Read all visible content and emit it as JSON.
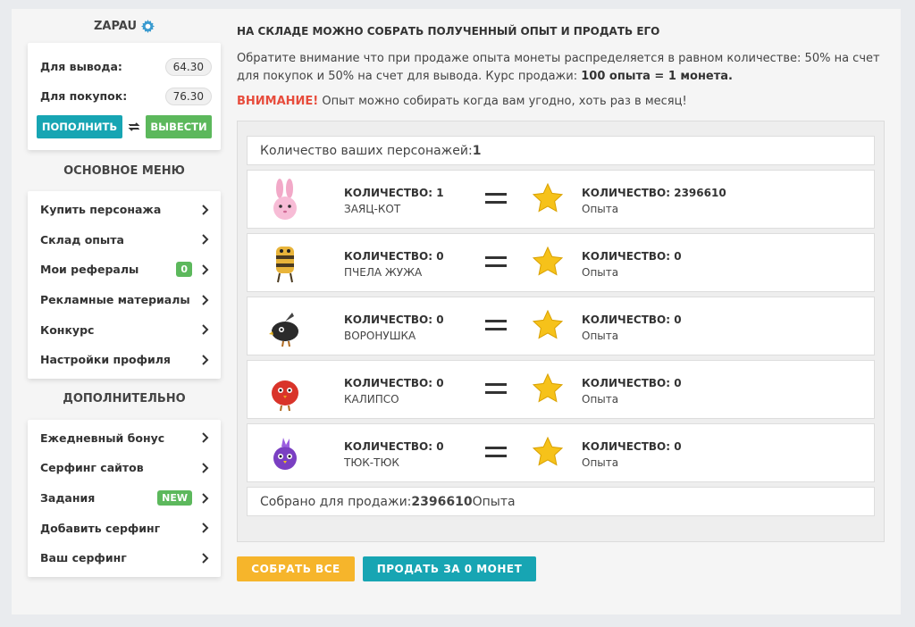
{
  "user": {
    "name": "ZAPAU"
  },
  "balance": {
    "withdraw_label": "Для вывода:",
    "withdraw_value": "64.30",
    "purchase_label": "Для покупок:",
    "purchase_value": "76.30",
    "topup_label": "ПОПОЛНИТЬ",
    "withdraw_button": "ВЫВЕСТИ"
  },
  "main_menu": {
    "title": "ОСНОВНОЕ МЕНЮ",
    "items": [
      {
        "label": "Купить персонажа"
      },
      {
        "label": "Склад опыта"
      },
      {
        "label": "Мои рефералы",
        "badge": "0"
      },
      {
        "label": "Рекламные материалы"
      },
      {
        "label": "Конкурс"
      },
      {
        "label": "Настройки профиля"
      }
    ]
  },
  "extra_menu": {
    "title": "ДОПОЛНИТЕЛЬНО",
    "items": [
      {
        "label": "Ежедневный бонус"
      },
      {
        "label": "Серфинг сайтов"
      },
      {
        "label": "Задания",
        "badge": "NEW"
      },
      {
        "label": "Добавить серфинг"
      },
      {
        "label": "Ваш серфинг"
      }
    ]
  },
  "main": {
    "title": "НА СКЛАДЕ МОЖНО СОБРАТЬ ПОЛУЧЕННЫЙ ОПЫТ И ПРОДАТЬ ЕГО",
    "desc_text": "Обратите внимание что при продаже опыта монеты распределяется в равном количестве: 50% на счет для покупок и 50% на счет для вывода. Курс продажи: ",
    "desc_rate": "100 опыта = 1 монета.",
    "warn_label": "ВНИМАНИЕ!",
    "warn_text": " Опыт можно собирать когда вам угодно, хоть раз в месяц!",
    "count_label": "Количество ваших персонажей: ",
    "count_value": "1",
    "total_label": "Собрано для продажи: ",
    "total_value": "2396610",
    "total_unit": " Опыта",
    "collect_button": "СОБРАТЬ ВСЕ",
    "sell_button": "ПРОДАТЬ ЗА 0 МОНЕТ"
  },
  "pets": [
    {
      "qty": "КОЛИЧЕСТВО: 1",
      "name": "ЗАЯЦ-КОТ",
      "exp_qty": "КОЛИЧЕСТВО: 2396610",
      "exp_label": "Опыта",
      "icon": "bunny-cat-icon"
    },
    {
      "qty": "КОЛИЧЕСТВО: 0",
      "name": "ПЧЕЛА ЖУЖА",
      "exp_qty": "КОЛИЧЕСТВО: 0",
      "exp_label": "Опыта",
      "icon": "bee-icon"
    },
    {
      "qty": "КОЛИЧЕСТВО: 0",
      "name": "ВОРОНУШКА",
      "exp_qty": "КОЛИЧЕСТВО: 0",
      "exp_label": "Опыта",
      "icon": "crow-icon"
    },
    {
      "qty": "КОЛИЧЕСТВО: 0",
      "name": "КАЛИПСО",
      "exp_qty": "КОЛИЧЕСТВО: 0",
      "exp_label": "Опыта",
      "icon": "red-bird-icon"
    },
    {
      "qty": "КОЛИЧЕСТВО: 0",
      "name": "ТЮК-ТЮК",
      "exp_qty": "КОЛИЧЕСТВО: 0",
      "exp_label": "Опыта",
      "icon": "purple-bird-icon"
    }
  ],
  "colors": {
    "accent_teal": "#17a5b3",
    "accent_green": "#5cb85c",
    "accent_yellow": "#f6b52b",
    "warning_red": "#e74c3c"
  }
}
